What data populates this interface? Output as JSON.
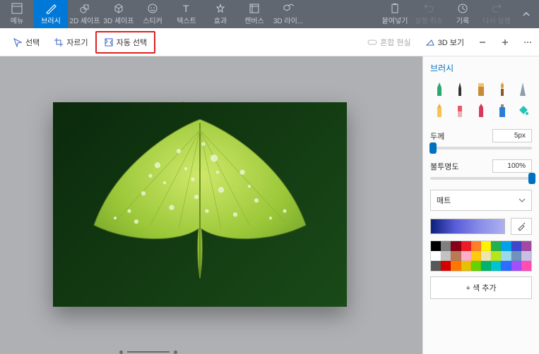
{
  "topbar": {
    "menu": "메뉴",
    "brush": "브러시",
    "shape2d": "2D 셰이프",
    "shape3d": "3D 셰이프",
    "sticker": "스티커",
    "text": "텍스트",
    "effects": "효과",
    "canvas": "캔버스",
    "lib3d": "3D 라이...",
    "paste": "붙여넣기",
    "undo": "실행 취소",
    "history": "기록",
    "redo": "다시 실행"
  },
  "toolbar": {
    "select": "선택",
    "crop": "자르기",
    "autoselect": "자동 선택",
    "mixedreality": "혼합 현실",
    "view3d": "3D 보기"
  },
  "panel": {
    "title": "브러시",
    "thickness_label": "두께",
    "thickness_value": "5px",
    "opacity_label": "불투명도",
    "opacity_value": "100%",
    "material": "매트",
    "add_color": "+  색 추가"
  },
  "palette": [
    "#000000",
    "#7f7f7f",
    "#880015",
    "#ed1c24",
    "#ff7f27",
    "#fff200",
    "#22b14c",
    "#00a2e8",
    "#3f48cc",
    "#a349a4",
    "#ffffff",
    "#c3c3c3",
    "#b97a57",
    "#ffaec9",
    "#ffc90e",
    "#efe4b0",
    "#b5e61d",
    "#99d9ea",
    "#7092be",
    "#c8bfe7",
    "#585858",
    "#d60000",
    "#ff7700",
    "#e5c100",
    "#69d100",
    "#00b46c",
    "#00c5cf",
    "#2f6cff",
    "#a050ff",
    "#ff4db2"
  ],
  "sliders": {
    "thickness_percent": 3,
    "opacity_percent": 100
  }
}
